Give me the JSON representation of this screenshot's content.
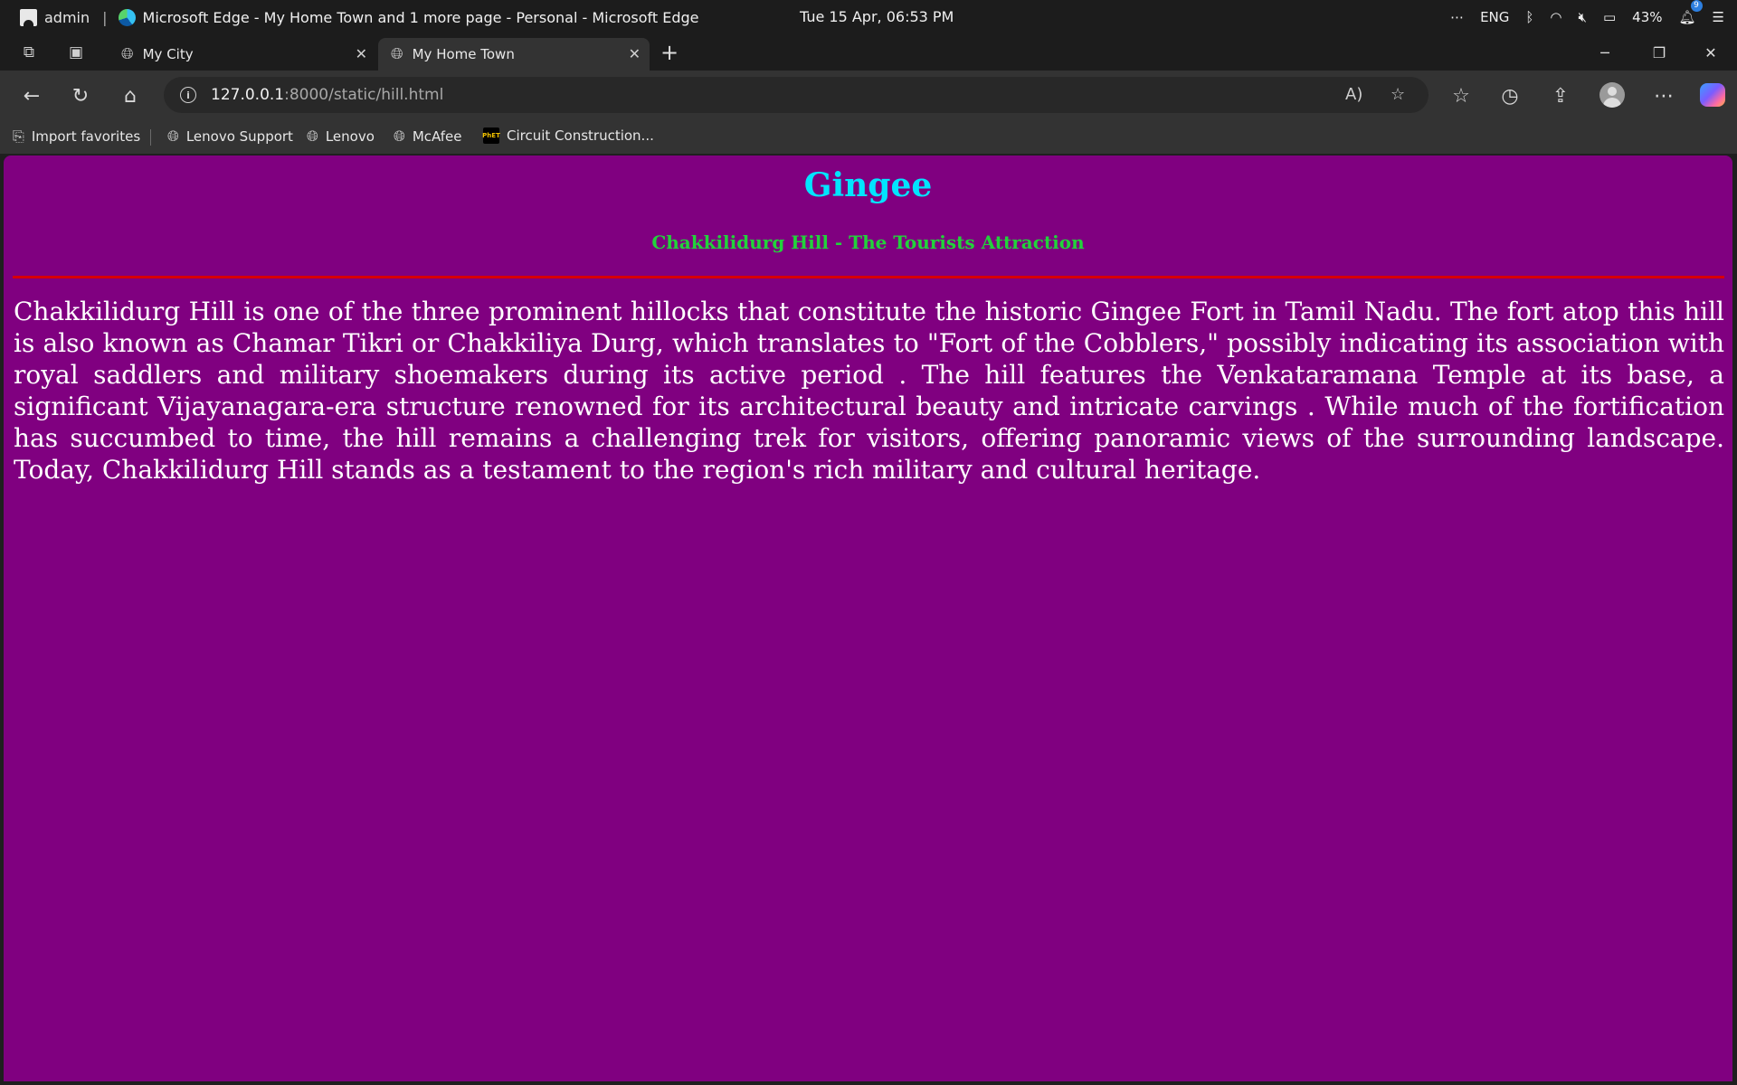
{
  "system_bar": {
    "user": "admin",
    "separator": "|",
    "window_title": "Microsoft Edge  -  My Home Town and 1 more page - Personal - Microsoft Edge",
    "clock": "Tue 15 Apr, 06:53 PM",
    "overflow_icon": "ellipsis-icon",
    "language": "ENG",
    "battery": "43%",
    "notification_count": "9"
  },
  "tabs": [
    {
      "label": "My City",
      "icon": "globe-icon"
    },
    {
      "label": "My Home Town",
      "icon": "globe-icon"
    }
  ],
  "address_bar": {
    "url_host": "127.0.0.1",
    "url_path": ":8000/static/hill.html"
  },
  "favorites": [
    {
      "label": "Import favorites",
      "icon": "import-icon"
    },
    {
      "label": "Lenovo Support",
      "icon": "globe-icon"
    },
    {
      "label": "Lenovo",
      "icon": "globe-icon"
    },
    {
      "label": "McAfee",
      "icon": "globe-icon"
    },
    {
      "label": "Circuit Construction...",
      "icon": "phet-icon"
    }
  ],
  "page": {
    "title": "Gingee",
    "subtitle": "Chakkilidurg Hill - The Tourists Attraction",
    "body": "Chakkilidurg Hill is one of the three prominent hillocks that constitute the historic Gingee Fort in Tamil Nadu. The fort atop this hill is also known as Chamar Tikri or Chakkiliya Durg, which translates to \"Fort of the Cobblers,\" possibly indicating its association with royal saddlers and military shoemakers during its active period . The hill features the Venkataramana Temple at its base, a significant Vijayanagara-era structure renowned for its architectural beauty and intricate carvings . While much of the fortification has succumbed to time, the hill remains a challenging trek for visitors, offering panoramic views of the surrounding landscape. Today, Chakkilidurg Hill stands as a testament to the region's rich military and cultural heritage."
  },
  "colors": {
    "page_background": "#800080",
    "title": "#00e5ff",
    "subtitle": "#22d33b",
    "rule": "#d80000",
    "body_text": "#ffffff",
    "browser_chrome": "#333333"
  }
}
